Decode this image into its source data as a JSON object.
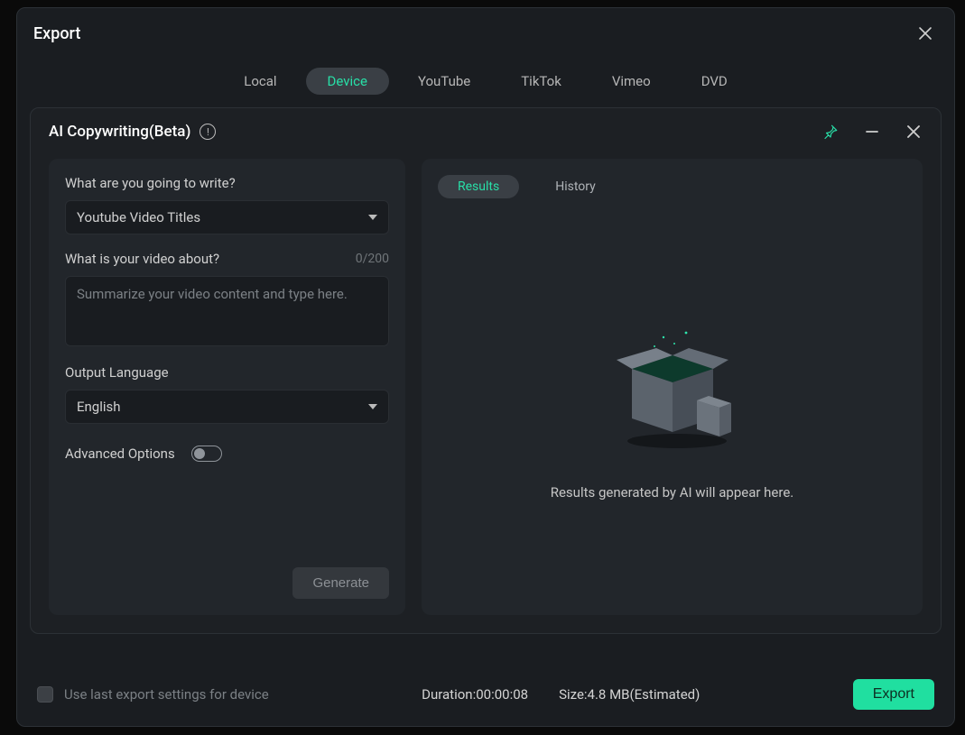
{
  "outer": {
    "title": "Export",
    "tabs": {
      "local": "Local",
      "device": "Device",
      "youtube": "YouTube",
      "tiktok": "TikTok",
      "vimeo": "Vimeo",
      "dvd": "DVD"
    }
  },
  "inner": {
    "title": "AI Copywriting(Beta)"
  },
  "form": {
    "q1_label": "What are you going to write?",
    "write_type": "Youtube Video Titles",
    "q2_label": "What is your video about?",
    "char_count": "0/200",
    "about_placeholder": "Summarize your video content and type here.",
    "lang_label": "Output Language",
    "lang_value": "English",
    "adv_label": "Advanced Options",
    "generate_label": "Generate"
  },
  "results": {
    "results_tab": "Results",
    "history_tab": "History",
    "empty_text": "Results generated by AI will appear here."
  },
  "footer": {
    "use_last": "Use last export settings for device",
    "duration_label": "Duration:",
    "duration_value": "00:00:08",
    "size_label": "Size:",
    "size_value": "4.8 MB(Estimated)",
    "export_label": "Export"
  },
  "colors": {
    "accent": "#28e0a8"
  }
}
